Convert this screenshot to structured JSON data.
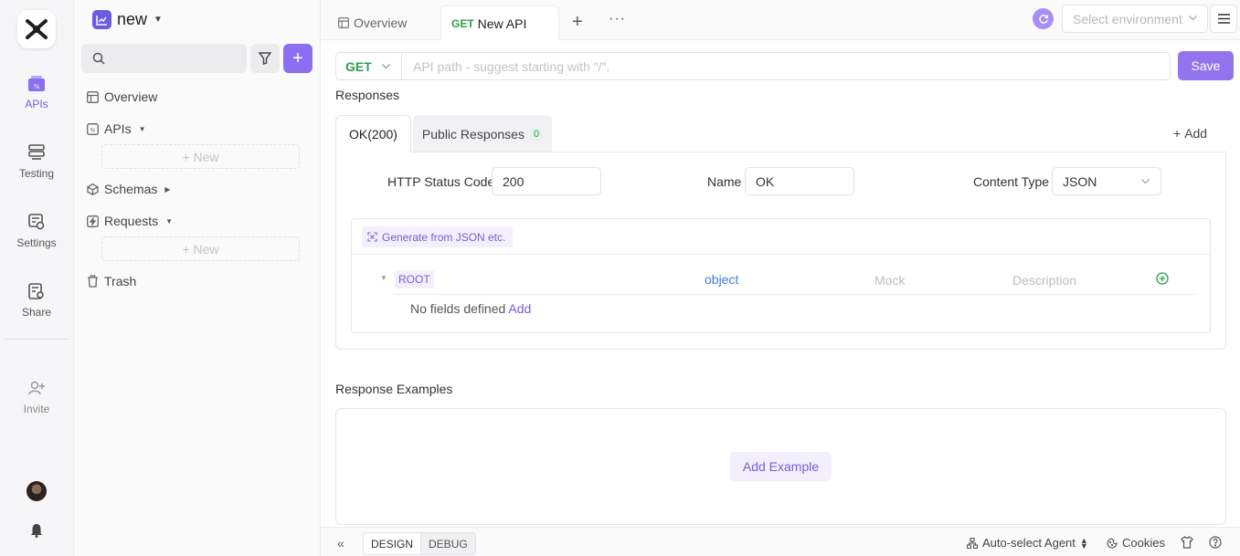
{
  "colors": {
    "accent": "#8c6ff0",
    "get": "#2e9e4c",
    "link": "#3f7bd9"
  },
  "rail": {
    "items": [
      {
        "label": "APIs",
        "icon": "api-icon"
      },
      {
        "label": "Testing",
        "icon": "testing-icon"
      },
      {
        "label": "Settings",
        "icon": "settings-icon"
      },
      {
        "label": "Share",
        "icon": "share-icon"
      },
      {
        "label": "Invite",
        "icon": "invite-icon"
      }
    ]
  },
  "sidebar": {
    "project_name": "new",
    "search_placeholder": "",
    "items": [
      {
        "label": "Overview"
      },
      {
        "label": "APIs"
      },
      {
        "label": "Schemas"
      },
      {
        "label": "Requests"
      },
      {
        "label": "Trash"
      }
    ],
    "new_label": "+ New"
  },
  "tabs": {
    "overview": "Overview",
    "active_method": "GET",
    "active_label": "New API"
  },
  "env": {
    "placeholder": "Select environment"
  },
  "request": {
    "method": "GET",
    "path_placeholder": "API path - suggest starting with \"/\".",
    "save_label": "Save"
  },
  "responses": {
    "title": "Responses",
    "tab_ok": "OK(200)",
    "tab_public": "Public Responses",
    "public_count": "0",
    "add_label": "Add",
    "status_code_label": "HTTP Status Code",
    "status_code_value": "200",
    "name_label": "Name",
    "name_value": "OK",
    "content_type_label": "Content Type",
    "content_type_value": "JSON",
    "generate_label": "Generate from JSON etc.",
    "root_label": "ROOT",
    "root_type": "object",
    "mock_placeholder": "Mock",
    "description_placeholder": "Description",
    "no_fields_text": "No fields defined",
    "no_fields_add": "Add"
  },
  "examples": {
    "title": "Response Examples",
    "add_label": "Add Example"
  },
  "bottom": {
    "design": "DESIGN",
    "debug": "DEBUG",
    "agent": "Auto-select Agent",
    "cookies": "Cookies"
  }
}
